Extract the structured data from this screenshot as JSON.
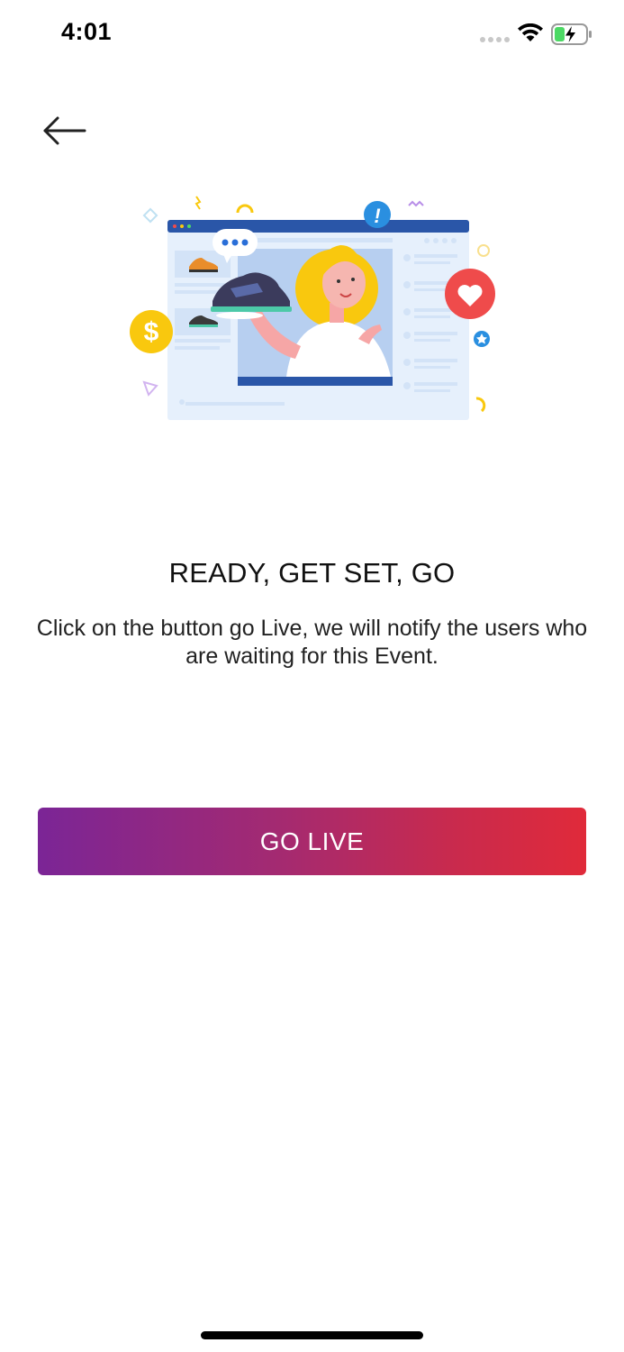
{
  "status_bar": {
    "time": "4:01",
    "icons": [
      "signal-dots-icon",
      "wifi-icon",
      "battery-charging-icon"
    ]
  },
  "navigation": {
    "back_icon": "arrow-left-icon"
  },
  "illustration": {
    "description_icons": [
      "browser-window",
      "shoe",
      "chat-bubble",
      "heart-icon",
      "dollar-coin-icon",
      "exclamation-icon",
      "star-icon"
    ]
  },
  "content": {
    "headline": "READY, GET SET, GO",
    "description": "Click on the button go Live, we will notify the users who are waiting for this Event."
  },
  "actions": {
    "go_live_label": "GO LIVE"
  },
  "colors": {
    "gradient_start": "#7b2596",
    "gradient_end": "#e02a3a",
    "browser_blue": "#2a56a8",
    "accent_yellow": "#f9c80e",
    "heart_red": "#ef4b4b"
  }
}
